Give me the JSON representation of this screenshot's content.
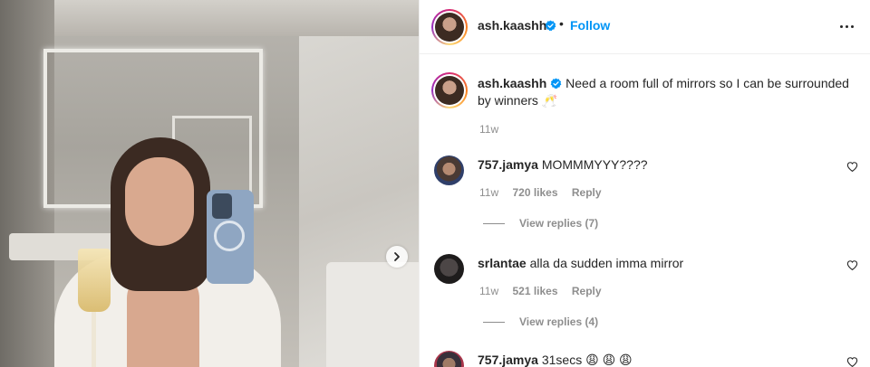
{
  "post": {
    "username": "ash.kaashh",
    "separator": "•",
    "follow_label": "Follow",
    "caption": "Need a room full of mirrors so I can be surrounded by winners 🥂",
    "caption_time": "11w"
  },
  "comments": [
    {
      "username": "757.jamya",
      "text": "MOMMMYYY????",
      "time": "11w",
      "likes": "720 likes",
      "reply_label": "Reply",
      "view_replies": "View replies (7)"
    },
    {
      "username": "srlantae",
      "text": "alla da sudden imma mirror",
      "time": "11w",
      "likes": "521 likes",
      "reply_label": "Reply",
      "view_replies": "View replies (4)"
    },
    {
      "username": "757.jamya",
      "text": "31secs 😩 😩 😩"
    }
  ],
  "icons": {
    "verified": "verified-badge-icon",
    "more": "more-options-icon",
    "heart": "heart-icon",
    "next": "chevron-right-icon"
  },
  "colors": {
    "accent": "#0095f6",
    "verified": "#0095f6",
    "muted": "#8e8e8e",
    "text": "#262626"
  }
}
